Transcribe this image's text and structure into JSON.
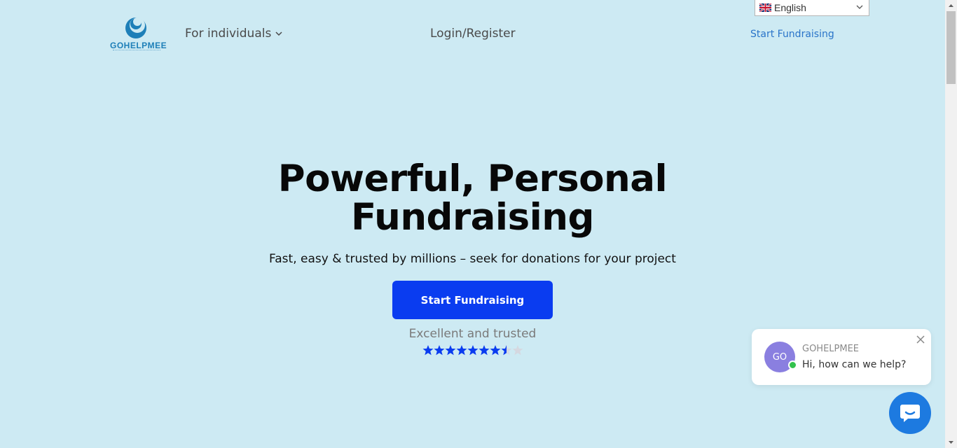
{
  "header": {
    "logo_text": "GOHELPMEE",
    "nav_individuals": "For individuals",
    "nav_login": "Login/Register",
    "nav_start": "Start Fundraising",
    "language": "English"
  },
  "hero": {
    "title_line1": "Powerful, Personal",
    "title_line2": "Fundraising",
    "subtitle": "Fast, easy & trusted by millions – seek for donations for your project",
    "cta_label": "Start Fundraising",
    "trust_text": "Excellent and trusted",
    "rating": {
      "value": 7.5,
      "max": 9
    }
  },
  "chat": {
    "avatar_initials": "GO",
    "name": "GOHELPMEE",
    "message": "Hi, how can we help?"
  },
  "colors": {
    "background": "#cdeaf3",
    "cta": "#0a3cf0",
    "star": "#0a3cf0",
    "star_empty": "#d5d8e0",
    "chat_launcher": "#1d7ae0"
  }
}
